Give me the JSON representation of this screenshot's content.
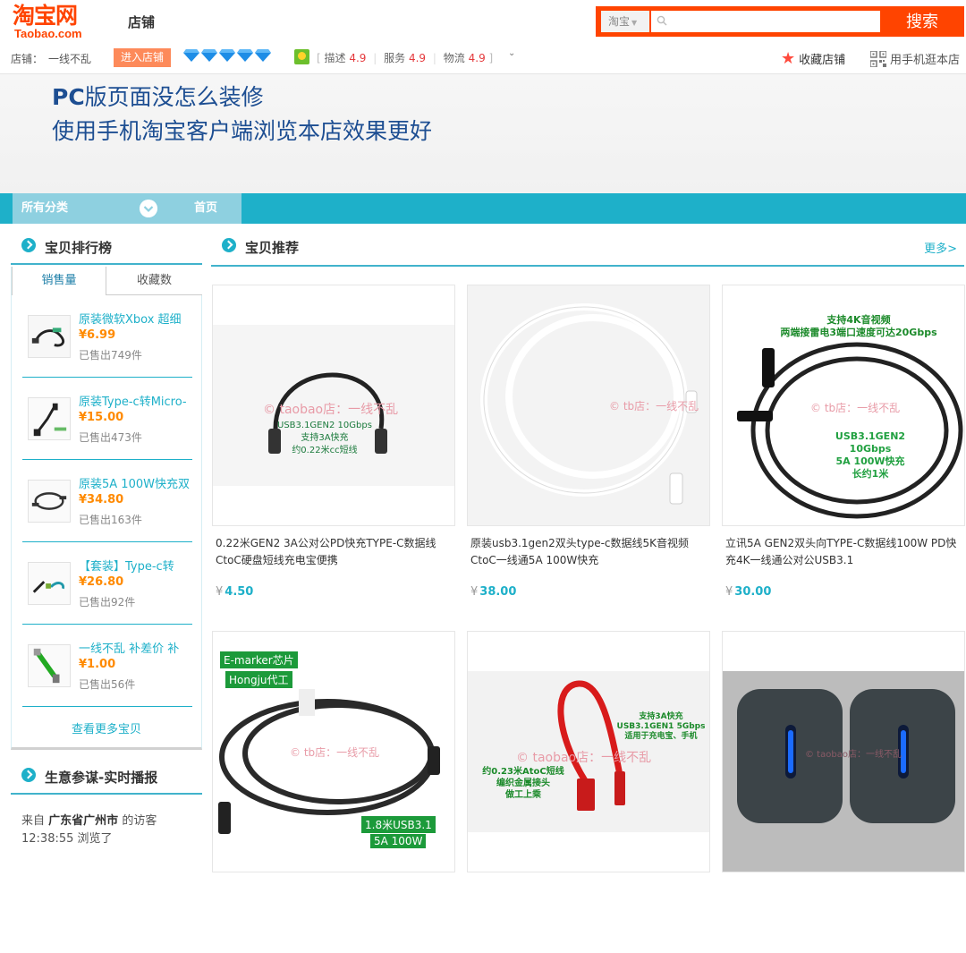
{
  "header": {
    "logo_cn": "淘宝网",
    "logo_en": "Taobao.com",
    "section": "店铺",
    "search_scope": "淘宝",
    "search_placeholder": "",
    "search_button": "搜索"
  },
  "shop": {
    "label": "店铺：",
    "name": "一线不乱",
    "enter_button": "进入店铺",
    "ratings": [
      {
        "label": "描述",
        "value": "4.9"
      },
      {
        "label": "服务",
        "value": "4.9"
      },
      {
        "label": "物流",
        "value": "4.9"
      }
    ],
    "favorite": "收藏店铺",
    "mobile": "用手机逛本店",
    "accent": "#1eb0c9",
    "brand": "#ff4400"
  },
  "banner": {
    "line1_bold": "PC",
    "line1_rest": "版页面没怎么装修",
    "line2": "使用手机淘宝客户端浏览本店效果更好"
  },
  "nav": {
    "all_categories": "所有分类",
    "home": "首页"
  },
  "ranking": {
    "title": "宝贝排行榜",
    "tab_sales": "销售量",
    "tab_favorites": "收藏数",
    "items": [
      {
        "name": "原装微软Xbox 超细",
        "price": "¥6.99",
        "sold_prefix": "已售出",
        "sold": "749",
        "sold_suffix": "件"
      },
      {
        "name": "原装Type-c转Micro-",
        "price": "¥15.00",
        "sold_prefix": "已售出",
        "sold": "473",
        "sold_suffix": "件"
      },
      {
        "name": "原装5A 100W快充双",
        "price": "¥34.80",
        "sold_prefix": "已售出",
        "sold": "163",
        "sold_suffix": "件"
      },
      {
        "name": "【套装】Type-c转",
        "price": "¥26.80",
        "sold_prefix": "已售出",
        "sold": "92",
        "sold_suffix": "件"
      },
      {
        "name": "一线不乱 补差价 补",
        "price": "¥1.00",
        "sold_prefix": "已售出",
        "sold": "56",
        "sold_suffix": "件"
      }
    ],
    "see_more": "查看更多宝贝"
  },
  "live": {
    "title": "生意参谋-实时播报",
    "from": "来自",
    "location": "广东省广州市",
    "visitor": "的访客",
    "time": "12:38:55",
    "action": "浏览了"
  },
  "recommend": {
    "title": "宝贝推荐",
    "more": "更多>",
    "products": [
      {
        "title": "0.22米GEN2 3A公对公PD快充TYPE-C数据线CtoC硬盘短线充电宝便携",
        "yen": "¥",
        "price": "4.50",
        "watermark": "© taobao店：一线不乱",
        "img_text": [
          "USB3.1GEN2 10Gbps",
          "支持3A快充",
          "约0.22米cc短线"
        ]
      },
      {
        "title": "原装usb3.1gen2双头type-c数据线5K音视频CtoC一线通5A 100W快充",
        "yen": "¥",
        "price": "38.00",
        "watermark": "© tb店：一线不乱",
        "img_text": []
      },
      {
        "title": "立讯5A GEN2双头向TYPE-C数据线100W PD快充4K一线通公对公USB3.1",
        "yen": "¥",
        "price": "30.00",
        "watermark": "© tb店：一线不乱",
        "img_text": [
          "支持4K音视频",
          "两端接雷电3端口速度可达20Gbps",
          "USB3.1GEN2 10Gbps",
          "5A 100W快充",
          "长约1米"
        ]
      },
      {
        "title": "",
        "yen": "",
        "price": "",
        "watermark": "© tb店：一线不乱",
        "img_text": [
          "E-marker芯片",
          "Hongju代工",
          "1.8米USB3.1",
          "5A 100W"
        ]
      },
      {
        "title": "",
        "yen": "",
        "price": "",
        "watermark": "© taobao店：一线不乱",
        "img_text": [
          "支持3A快充",
          "USB3.1GEN1 5Gbps",
          "适用于充电宝、手机",
          "约0.23米AtoC短线",
          "编织金属接头",
          "做工上乘"
        ]
      },
      {
        "title": "",
        "yen": "",
        "price": "",
        "watermark": "© taobao店：一线不乱",
        "img_text": []
      }
    ]
  }
}
